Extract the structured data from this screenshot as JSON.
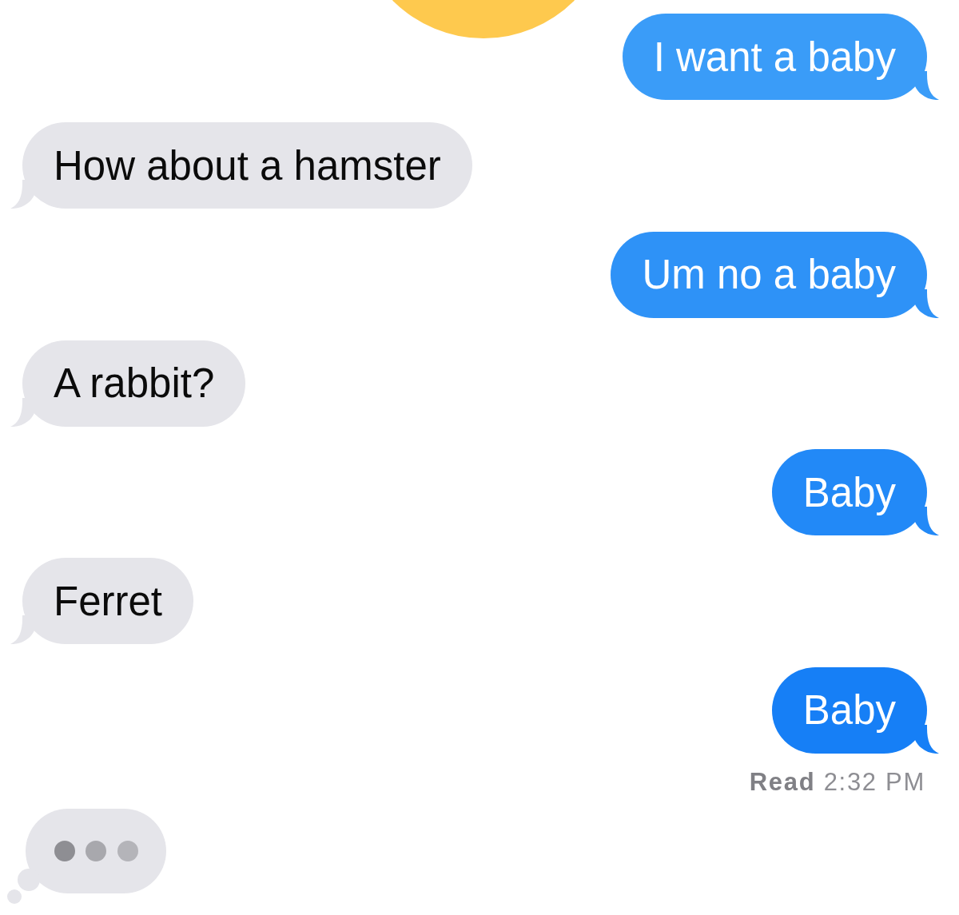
{
  "messages": [
    {
      "kind": "sent",
      "text": "I want a baby"
    },
    {
      "kind": "received",
      "text": "How about a hamster"
    },
    {
      "kind": "sent",
      "text": "Um no a baby"
    },
    {
      "kind": "received",
      "text": "A rabbit?"
    },
    {
      "kind": "sent",
      "text": "Baby"
    },
    {
      "kind": "received",
      "text": "Ferret"
    },
    {
      "kind": "sent",
      "text": "Baby"
    }
  ],
  "receipt": "**Read** 2:32 PM",
  "typing_indicator": {
    "dots": [
      {
        "color": "#8e8e93"
      },
      {
        "color": "#a8a8ad"
      },
      {
        "color": "#b4b4b9"
      }
    ]
  }
}
